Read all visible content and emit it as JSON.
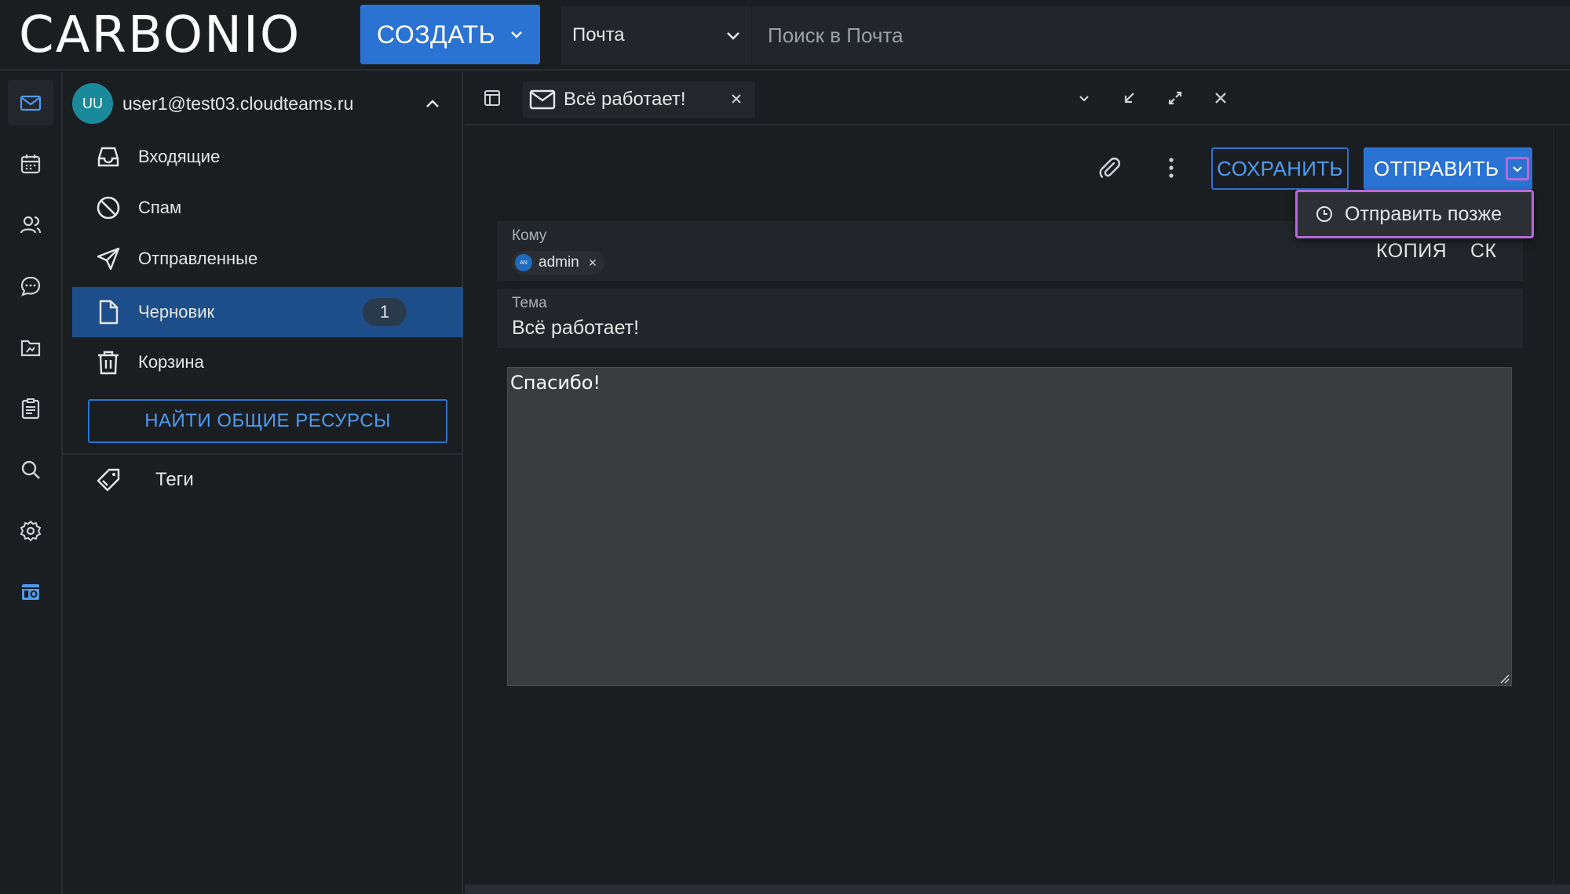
{
  "header": {
    "logo": "CARBONIO",
    "create_label": "СОЗДАТЬ",
    "module_label": "Почта",
    "search_placeholder": "Поиск в Почта"
  },
  "rail": {
    "items": [
      {
        "icon": "mail-icon",
        "active": true
      },
      {
        "icon": "calendar-icon"
      },
      {
        "icon": "contacts-icon"
      },
      {
        "icon": "chat-icon"
      },
      {
        "icon": "files-icon"
      },
      {
        "icon": "tasks-icon"
      },
      {
        "icon": "search-icon"
      },
      {
        "icon": "settings-icon"
      },
      {
        "icon": "apps-icon",
        "accent": true
      }
    ]
  },
  "sidebar": {
    "account": {
      "initials": "UU",
      "email": "user1@test03.cloudteams.ru"
    },
    "folders": [
      {
        "label": "Входящие",
        "icon": "inbox-icon"
      },
      {
        "label": "Спам",
        "icon": "spam-icon"
      },
      {
        "label": "Отправленные",
        "icon": "send-icon"
      },
      {
        "label": "Черновик",
        "icon": "draft-icon",
        "active": true,
        "count": "1"
      },
      {
        "label": "Корзина",
        "icon": "trash-icon"
      }
    ],
    "find_shared": "НАЙТИ ОБЩИЕ РЕСУРСЫ",
    "tags_label": "Теги"
  },
  "tab": {
    "title": "Всё работает!"
  },
  "composer": {
    "save_label": "СОХРАНИТЬ",
    "send_label": "ОТПРАВИТЬ",
    "send_later_label": "Отправить позже",
    "to_label": "Кому",
    "recipient": {
      "name": "admin",
      "initials": "AN"
    },
    "cc_label": "КОПИЯ",
    "bcc_label": "СК",
    "subject_label": "Тема",
    "subject_value": "Всё работает!",
    "body": "Спасибо!"
  },
  "colors": {
    "accent": "#2b73d2",
    "highlight": "#b36ad6",
    "background": "#1b1e21"
  }
}
